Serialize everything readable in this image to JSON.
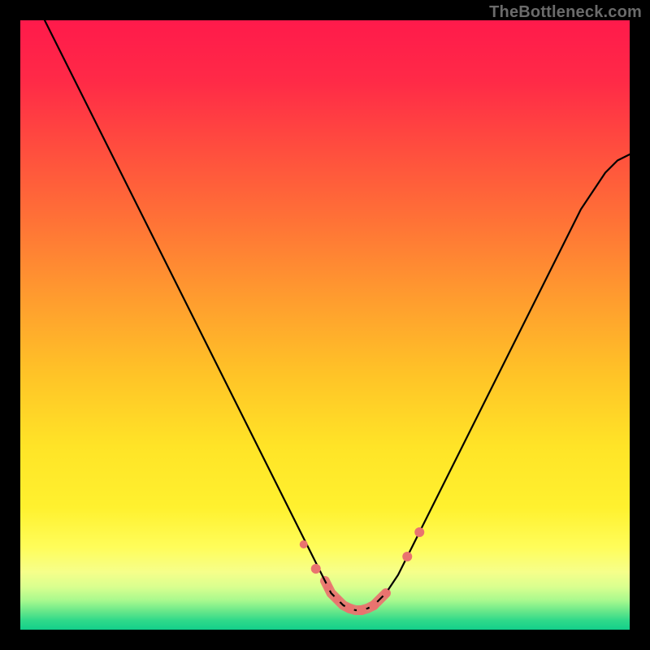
{
  "watermark": "TheBottleneck.com",
  "colors": {
    "frame": "#000000",
    "curve": "#000000",
    "marker": "#e9736f",
    "gradient_stops": [
      {
        "offset": 0.0,
        "color": "#ff1a4b"
      },
      {
        "offset": 0.1,
        "color": "#ff2a47"
      },
      {
        "offset": 0.2,
        "color": "#ff4a3f"
      },
      {
        "offset": 0.32,
        "color": "#ff6f37"
      },
      {
        "offset": 0.45,
        "color": "#ff9a2f"
      },
      {
        "offset": 0.58,
        "color": "#ffc327"
      },
      {
        "offset": 0.7,
        "color": "#ffe427"
      },
      {
        "offset": 0.8,
        "color": "#fff12f"
      },
      {
        "offset": 0.865,
        "color": "#fffd5a"
      },
      {
        "offset": 0.905,
        "color": "#f6ff8a"
      },
      {
        "offset": 0.93,
        "color": "#d9ff8f"
      },
      {
        "offset": 0.952,
        "color": "#a8f98e"
      },
      {
        "offset": 0.968,
        "color": "#6ee98a"
      },
      {
        "offset": 0.985,
        "color": "#2fd98a"
      },
      {
        "offset": 1.0,
        "color": "#13cf8a"
      }
    ]
  },
  "chart_data": {
    "type": "line",
    "title": "",
    "xlabel": "",
    "ylabel": "",
    "xlim": [
      0,
      100
    ],
    "ylim": [
      0,
      100
    ],
    "note": "x in percent across plot width; y is bottleneck percentage (0 = bottom/green, 100 = top/red). Curve is a V-shaped bottleneck profile.",
    "series": [
      {
        "name": "bottleneck-curve",
        "x": [
          4,
          6,
          8,
          10,
          12,
          14,
          16,
          18,
          20,
          22,
          24,
          26,
          28,
          30,
          32,
          34,
          36,
          38,
          40,
          42,
          44,
          46,
          48,
          50,
          51,
          52,
          53,
          54,
          55,
          56,
          57,
          58,
          59,
          60,
          62,
          64,
          66,
          68,
          70,
          72,
          74,
          76,
          78,
          80,
          82,
          84,
          86,
          88,
          90,
          92,
          94,
          96,
          98,
          100
        ],
        "y": [
          100,
          96,
          92,
          88,
          84,
          80,
          76,
          72,
          68,
          64,
          60,
          56,
          52,
          48,
          44,
          40,
          36,
          32,
          28,
          24,
          20,
          16,
          12,
          8,
          6,
          5,
          4,
          3.5,
          3.2,
          3.2,
          3.5,
          4,
          5,
          6,
          9,
          13,
          17,
          21,
          25,
          29,
          33,
          37,
          41,
          45,
          49,
          53,
          57,
          61,
          65,
          69,
          72,
          75,
          77,
          78
        ]
      }
    ],
    "markers": {
      "name": "highlighted-points",
      "color": "#e9736f",
      "points": [
        {
          "x": 46.5,
          "y": 14,
          "r": 5
        },
        {
          "x": 48.5,
          "y": 10,
          "r": 6
        },
        {
          "x": 50.5,
          "y": 7,
          "r": 5
        },
        {
          "x": 52.0,
          "y": 5,
          "r": 5
        },
        {
          "x": 54.0,
          "y": 3.5,
          "r": 6
        },
        {
          "x": 56.0,
          "y": 3.2,
          "r": 6
        },
        {
          "x": 58.0,
          "y": 4,
          "r": 6
        },
        {
          "x": 60.0,
          "y": 6,
          "r": 5
        },
        {
          "x": 63.5,
          "y": 12,
          "r": 6
        },
        {
          "x": 65.5,
          "y": 16,
          "r": 6
        }
      ]
    }
  }
}
